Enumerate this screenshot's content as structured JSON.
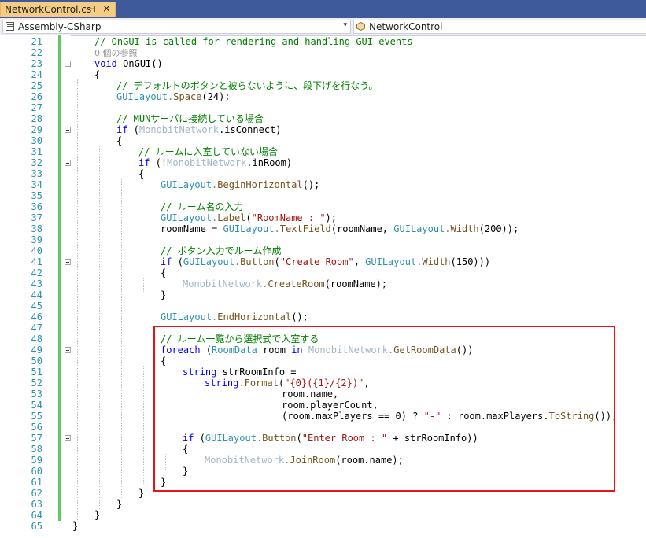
{
  "tab": {
    "title": "NetworkControl.cs",
    "pin": "⊣",
    "close": "×"
  },
  "navbar": {
    "project": "Assembly-CSharp",
    "class_name": "NetworkControl",
    "dropdown": "▾"
  },
  "line_numbers": [
    "21",
    "22",
    "23",
    "24",
    "25",
    "26",
    "27",
    "28",
    "29",
    "30",
    "31",
    "32",
    "33",
    "34",
    "35",
    "36",
    "37",
    "38",
    "39",
    "40",
    "41",
    "42",
    "43",
    "44",
    "45",
    "46",
    "47",
    "48",
    "49",
    "50",
    "51",
    "52",
    "53",
    "54",
    "55",
    "56",
    "57",
    "58",
    "59",
    "60",
    "61",
    "62",
    "63",
    "64",
    "65"
  ],
  "code": {
    "l21": {
      "comment": "// OnGUI is called for rendering and handling GUI events"
    },
    "l22": {
      "refs": "0 個の参照"
    },
    "l23": {
      "kw": "void",
      "name": "OnGUI",
      "rest": "()"
    },
    "l24": {
      "text": "{"
    },
    "l25": {
      "comment": "// デフォルトのボタンと被らないように、段下げを行なう。"
    },
    "l26": {
      "type": "GUILayout",
      "dot": ".",
      "method": "Space",
      "rest": "(24);"
    },
    "l27": {
      "text": ""
    },
    "l28": {
      "comment": "// MUNサーバに接続している場合"
    },
    "l29": {
      "kw": "if",
      "open": " (",
      "type": "MonobitNetwork",
      "rest": ".isConnect)"
    },
    "l30": {
      "text": "{"
    },
    "l31": {
      "comment": "// ルームに入室していない場合"
    },
    "l32": {
      "kw": "if",
      "open": " (!",
      "type": "MonobitNetwork",
      "rest": ".inRoom)"
    },
    "l33": {
      "text": "{"
    },
    "l34": {
      "type": "GUILayout",
      "dot": ".",
      "method": "BeginHorizontal",
      "rest": "();"
    },
    "l35": {
      "text": ""
    },
    "l36": {
      "comment": "// ルーム名の入力"
    },
    "l37": {
      "type": "GUILayout",
      "dot": ".",
      "method": "Label",
      "open": "(",
      "str": "\"RoomName : \"",
      "rest": ");"
    },
    "l38": {
      "pre": "roomName = ",
      "type": "GUILayout",
      "dot": ".",
      "method": "TextField",
      "mid": "(roomName, ",
      "type2": "GUILayout",
      "dot2": ".",
      "method2": "Width",
      "rest": "(200));"
    },
    "l39": {
      "text": ""
    },
    "l40": {
      "comment": "// ボタン入力でルーム作成"
    },
    "l41": {
      "kw": "if",
      "open": " (",
      "type": "GUILayout",
      "dot": ".",
      "method": "Button",
      "open2": "(",
      "str": "\"Create Room\"",
      "mid": ", ",
      "type2": "GUILayout",
      "dot2": ".",
      "method2": "Width",
      "rest": "(150)))"
    },
    "l42": {
      "text": "{"
    },
    "l43": {
      "type": "MonobitNetwork",
      "dot": ".",
      "method": "CreateRoom",
      "rest": "(roomName);"
    },
    "l44": {
      "text": "}"
    },
    "l45": {
      "text": ""
    },
    "l46": {
      "type": "GUILayout",
      "dot": ".",
      "method": "EndHorizontal",
      "rest": "();"
    },
    "l47": {
      "text": ""
    },
    "l48": {
      "comment": "// ルーム一覧から選択式で入室する"
    },
    "l49": {
      "kw": "foreach",
      "open": " (",
      "type": "RoomData",
      "mid": " room ",
      "kw2": "in",
      "sp": " ",
      "type2": "MonobitNetwork",
      "dot": ".",
      "method": "GetRoomData",
      "rest": "())"
    },
    "l50": {
      "text": "{"
    },
    "l51": {
      "kw": "string",
      "rest": " strRoomInfo ="
    },
    "l52": {
      "kw": "string",
      "dot": ".",
      "method": "Format",
      "open": "(",
      "str": "\"{0}({1}/{2})\"",
      "rest": ","
    },
    "l53": {
      "text": "room.name,"
    },
    "l54": {
      "text": "room.playerCount,"
    },
    "l55": {
      "pre": "(room.maxPlayers == 0) ? ",
      "str": "\"-\"",
      "mid": " : room.maxPlayers.",
      "method": "ToString",
      "rest": "());"
    },
    "l56": {
      "text": ""
    },
    "l57": {
      "kw": "if",
      "open": " (",
      "type": "GUILayout",
      "dot": ".",
      "method": "Button",
      "open2": "(",
      "str": "\"Enter Room : \"",
      "rest": " + strRoomInfo))"
    },
    "l58": {
      "text": "{"
    },
    "l59": {
      "type": "MonobitNetwork",
      "dot": ".",
      "method": "JoinRoom",
      "rest": "(room.name);"
    },
    "l60": {
      "text": "}"
    },
    "l61": {
      "text": "}"
    },
    "l62": {
      "text": "}"
    },
    "l63": {
      "text": "}"
    },
    "l64": {
      "text": "}"
    },
    "l65": {
      "text": "}"
    }
  },
  "colors": {
    "tab_active": "#f5cc84",
    "tab_bar": "#3e5a9b",
    "change_bar": "#5dcb5d",
    "highlight_border": "#e8121b",
    "comment": "#008000",
    "keyword": "#0000ff",
    "type": "#2b91af"
  }
}
